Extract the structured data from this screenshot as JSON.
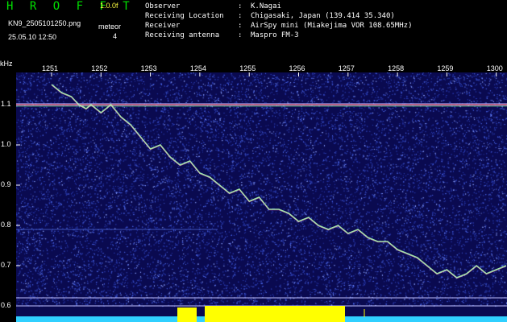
{
  "header": {
    "app_title": "H R O F F T",
    "version": "1.0.0f",
    "filename": "KN9_2505101250.png",
    "mode_label": "meteor",
    "mode_value": "4",
    "datetime": "25.05.10 12:50"
  },
  "info": {
    "observer_label": "Observer",
    "observer": "K.Nagai",
    "location_label": "Receiving Location",
    "location": "Chigasaki, Japan (139.414 35.340)",
    "receiver_label": "Receiver",
    "receiver": "AirSpy mini (Miakejima VOR 108.65MHz)",
    "antenna_label": "Receiving antenna",
    "antenna": "Maspro FM-3"
  },
  "axes": {
    "y_unit": "kHz",
    "y_ticks": [
      "1.1",
      "1.0",
      "0.9",
      "0.8",
      "0.7",
      "0.6"
    ],
    "x_ticks": [
      "1251",
      "1252",
      "1253",
      "1254",
      "1255",
      "1256",
      "1257",
      "1258",
      "1259",
      "1300"
    ]
  },
  "colors": {
    "background": "#0a0a50",
    "noise": "#3050d0",
    "trace": "#b0ffb0",
    "carrier": "#ff6060",
    "level": "#30d0ff",
    "meteor_level": "#ffff00",
    "title": "#00e000"
  },
  "chart_data": {
    "type": "line",
    "xlabel": "",
    "ylabel": "kHz",
    "x_ticks": [
      "1251",
      "1252",
      "1253",
      "1254",
      "1255",
      "1256",
      "1257",
      "1258",
      "1259",
      "1300"
    ],
    "ylim": [
      0.59,
      1.18
    ],
    "series": [
      {
        "x": [
          0.0,
          0.2,
          0.4,
          0.55,
          0.7,
          0.8,
          1.0,
          1.2,
          1.4,
          1.6,
          1.8,
          2.0,
          2.2,
          2.4,
          2.6,
          2.8,
          3.0,
          3.2,
          3.4,
          3.6,
          3.8,
          4.0,
          4.2,
          4.4,
          4.6,
          4.8,
          5.0,
          5.2,
          5.4,
          5.6,
          5.8,
          6.0,
          6.2,
          6.4,
          6.6,
          6.8,
          7.0,
          7.2,
          7.4,
          7.6,
          7.8,
          8.0,
          8.2,
          8.4,
          8.6,
          8.8,
          9.0,
          9.2
        ],
        "y": [
          1.15,
          1.13,
          1.12,
          1.1,
          1.09,
          1.1,
          1.08,
          1.1,
          1.07,
          1.05,
          1.02,
          0.99,
          1.0,
          0.97,
          0.95,
          0.96,
          0.93,
          0.92,
          0.9,
          0.88,
          0.89,
          0.86,
          0.87,
          0.84,
          0.84,
          0.83,
          0.81,
          0.82,
          0.8,
          0.79,
          0.8,
          0.78,
          0.79,
          0.77,
          0.76,
          0.76,
          0.74,
          0.73,
          0.72,
          0.7,
          0.68,
          0.69,
          0.67,
          0.68,
          0.7,
          0.68,
          0.69,
          0.7
        ]
      }
    ],
    "carrier_khz": 1.1
  }
}
